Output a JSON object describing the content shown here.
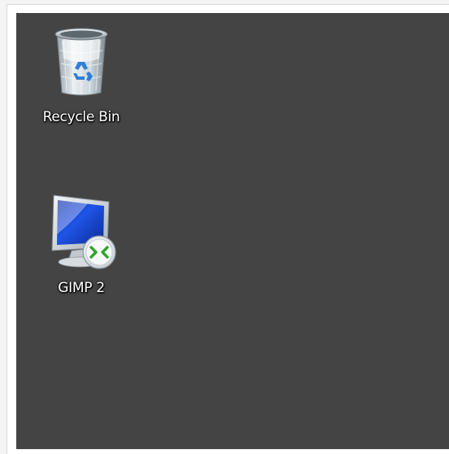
{
  "desktop": {
    "background_color": "#444444",
    "icons": [
      {
        "label": "Recycle Bin",
        "icon": "recycle-bin-icon"
      },
      {
        "label": "GIMP 2",
        "icon": "remote-desktop-icon"
      }
    ]
  }
}
